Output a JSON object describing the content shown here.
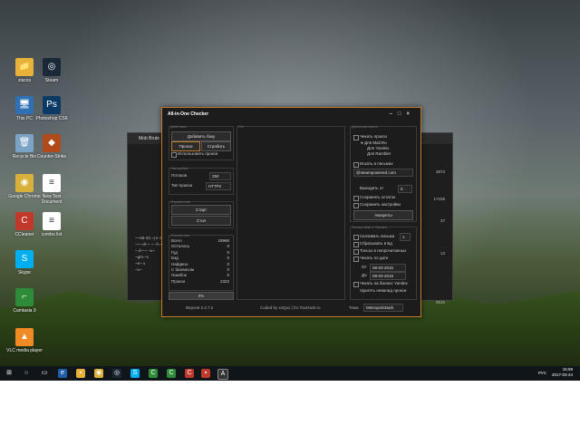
{
  "desktop": {
    "icons": [
      {
        "label": "ziscos",
        "color": "#e8b13a",
        "glyph": "📁"
      },
      {
        "label": "Steam",
        "color": "#1b2838",
        "glyph": "◎"
      },
      {
        "label": "This PC",
        "color": "#2f6fb3",
        "glyph": "🖥"
      },
      {
        "label": "Photoshop CS6",
        "color": "#0b3a66",
        "glyph": "Ps"
      },
      {
        "label": "Recycle Bin",
        "color": "#7ba3c5",
        "glyph": "🗑"
      },
      {
        "label": "Counter-Strike",
        "color": "#b04a1b",
        "glyph": "◆"
      },
      {
        "label": "Google Chrome",
        "color": "#d9b13a",
        "glyph": "◉"
      },
      {
        "label": "New Text Document",
        "color": "#ffffff",
        "glyph": "≡"
      },
      {
        "label": "CCleaner",
        "color": "#c0392b",
        "glyph": "C"
      },
      {
        "label": "combo list",
        "color": "#ffffff",
        "glyph": "≡"
      },
      {
        "label": "Skype",
        "color": "#00aff0",
        "glyph": "S"
      },
      {
        "label": "Camtasia 9",
        "color": "#2e8b3a",
        "glyph": "⌐"
      },
      {
        "label": "VLC media player",
        "color": "#f08a24",
        "glyph": "▲"
      }
    ]
  },
  "bg_window": {
    "title": "Mob Brute",
    "rows": [
      "~~46-43 ~j-e Sim",
      "~~--dr-~ ~ ~h~",
      "~ d~-~ ~x~",
      "~gm-~c",
      "~e~ x",
      "~x~"
    ],
    "nums": [
      "3873",
      "",
      "",
      "",
      "",
      "17438",
      "",
      "",
      "",
      "37",
      "",
      "",
      "",
      "",
      "",
      "13",
      "",
      "",
      "",
      "",
      "",
      "",
      "",
      "",
      "0515"
    ]
  },
  "app": {
    "title": "All-in-One Checker",
    "actions": {
      "group": "Действия",
      "add_base": "Добавить базу",
      "proxy": "Прокси",
      "grab": "Сграбить",
      "use_proxy": "Использовать прокси"
    },
    "settings": {
      "group": "Настройки",
      "threads_label": "Потоков",
      "threads_value": "250",
      "proxy_type_label": "Тип прокси",
      "proxy_type_value": "HTTPs"
    },
    "control": {
      "group": "Управление",
      "start": "Старт",
      "stop": "Стоп"
    },
    "stats": {
      "group": "Статистика",
      "items": [
        {
          "label": "Всего",
          "value": "18968"
        },
        {
          "label": "Осталось",
          "value": "0"
        },
        {
          "label": "Гуд",
          "value": "0"
        },
        {
          "label": "Бэд",
          "value": "0"
        },
        {
          "label": "Найдено",
          "value": "0"
        },
        {
          "label": "С балансом",
          "value": "0"
        },
        {
          "label": "Ошибок",
          "value": "0"
        },
        {
          "label": "Прокси",
          "value": "2322"
        }
      ],
      "progress": "0%",
      "progress_fraction": 0
    },
    "log": {
      "group": "Лог"
    },
    "extra": {
      "group": "Дополнительно",
      "check_proxy": "Чекать прокси",
      "mail_ru": "Для Mail.Ru",
      "yandex": "Для Yandex",
      "rambler": "Для Rambler",
      "search_in_mail": "Искать в письмах",
      "search_value": "@steampowered.com",
      "output_from": "Выводить от",
      "output_value": "0",
      "save_rest": "Сохранять остаток",
      "save_settings": "Сохранить настройки",
      "accounts": "Аккаунты"
    },
    "mail_yandex": {
      "group": "Только Mail и Yandex",
      "download_letters": "Скачивать письма",
      "download_value": "1",
      "throw_to_bd": "Сбрасывать в Бд",
      "only_unread": "Только в непрочитанных",
      "check_by_date": "Чекать по дате",
      "from_label": "От",
      "from_date": "08-03-2015",
      "to_label": "До",
      "to_date": "08-03-2015",
      "check_yandex_balance": "Чекать на баланс Yandex",
      "delete_proxy_if": "Удалять невалид прокси"
    },
    "footer": {
      "version": "Версия 2.4.7.2",
      "coded_by": "Coded by xxQox | for YouHack.ru",
      "theme_label": "Тема",
      "theme_value": "MetropolisDark"
    }
  },
  "taskbar": {
    "time": "15:59",
    "date": "2017-03-24",
    "lang": "РУС"
  }
}
